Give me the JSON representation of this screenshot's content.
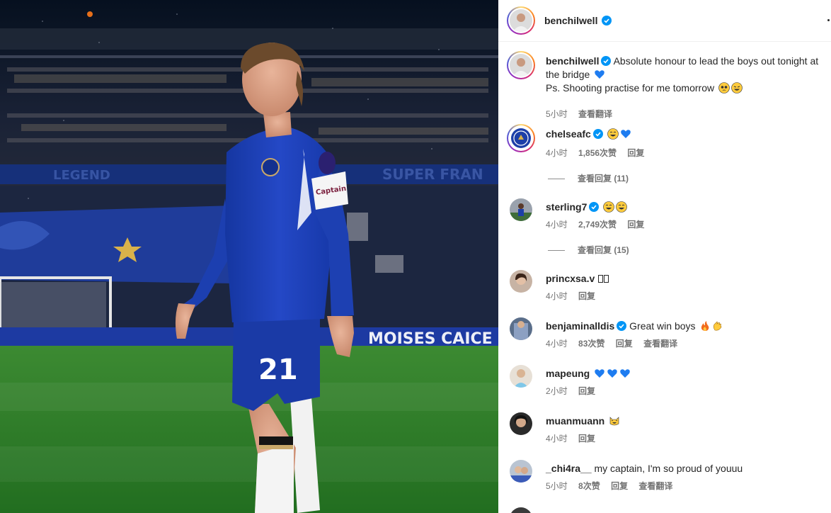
{
  "post": {
    "author": "benchilwell",
    "caption_line1": "Absolute honour to lead the boys out tonight at the bridge",
    "caption_line2": "Ps. Shooting practise for me tomorrow",
    "caption_time": "5小时",
    "caption_translate": "查看翻译",
    "photo_text": {
      "shirt_number": "21",
      "armband": "Captain",
      "board_left": "LEGEND",
      "board_right": "SUPER FRAN",
      "board_bottom": "MOISES CAICE"
    }
  },
  "comments": [
    {
      "user": "chelseafc",
      "verified": true,
      "text": "",
      "emojis": [
        "grin-sweat",
        "blue-heart"
      ],
      "time": "4小时",
      "likes": "1,856次赞",
      "reply": "回复",
      "translate": "",
      "view_replies": "查看回复 (11)"
    },
    {
      "user": "sterling7",
      "verified": true,
      "text": "",
      "emojis": [
        "grin-sweat",
        "grin-sweat"
      ],
      "time": "4小时",
      "likes": "2,749次赞",
      "reply": "回复",
      "translate": "",
      "view_replies": "查看回复 (15)"
    },
    {
      "user": "princxsa.v",
      "verified": false,
      "text": "",
      "emojis": [
        "missing-glyph",
        "missing-glyph"
      ],
      "time": "4小时",
      "likes": "",
      "reply": "回复",
      "translate": "",
      "view_replies": ""
    },
    {
      "user": "benjaminalldis",
      "verified": true,
      "text": "Great win boys",
      "emojis": [
        "fire",
        "clap"
      ],
      "time": "4小时",
      "likes": "83次赞",
      "reply": "回复",
      "translate": "查看翻译",
      "view_replies": ""
    },
    {
      "user": "mapeung",
      "verified": false,
      "text": "",
      "emojis": [
        "blue-heart",
        "blue-heart",
        "blue-heart"
      ],
      "time": "2小时",
      "likes": "",
      "reply": "回复",
      "translate": "",
      "view_replies": ""
    },
    {
      "user": "muanmuann",
      "verified": false,
      "text": "",
      "emojis": [
        "cat-grin"
      ],
      "time": "4小时",
      "likes": "",
      "reply": "回复",
      "translate": "",
      "view_replies": ""
    },
    {
      "user": "_chi4ra__",
      "verified": false,
      "text": "my captain, I'm so proud of youuu",
      "emojis": [],
      "time": "5小时",
      "likes": "8次赞",
      "reply": "回复",
      "translate": "查看翻译",
      "view_replies": ""
    }
  ],
  "colors": {
    "verified_blue": "#0095f6",
    "chelsea_blue": "#1d3fa8",
    "pitch_green": "#2f7a2a",
    "meta_grey": "#737373"
  }
}
